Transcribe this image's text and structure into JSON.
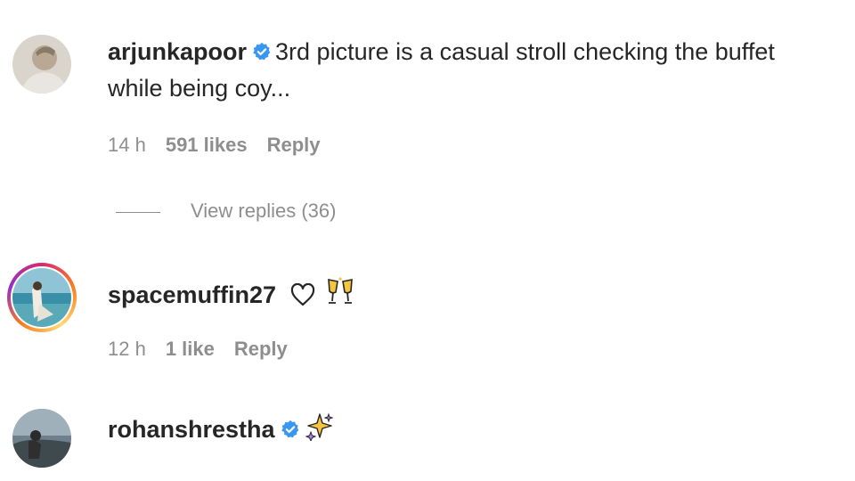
{
  "comments": [
    {
      "username": "arjunkapoor",
      "verified": true,
      "text_line1": "3rd picture is a casual stroll checking the buffet",
      "text_line2": "while being coy...",
      "time": "14 h",
      "likes": "591 likes",
      "reply_label": "Reply",
      "view_replies": "View replies (36)"
    },
    {
      "username": "spacemuffin27",
      "verified": false,
      "has_story_ring": true,
      "emojis": [
        "heart-outline-icon",
        "clinking-glasses-icon"
      ],
      "time": "12 h",
      "likes": "1 like",
      "reply_label": "Reply"
    },
    {
      "username": "rohanshrestha",
      "verified": true,
      "emojis": [
        "sparkles-icon"
      ]
    }
  ],
  "colors": {
    "verified_blue": "#3897f0",
    "meta_gray": "#8e8e8e",
    "text": "#262626"
  }
}
